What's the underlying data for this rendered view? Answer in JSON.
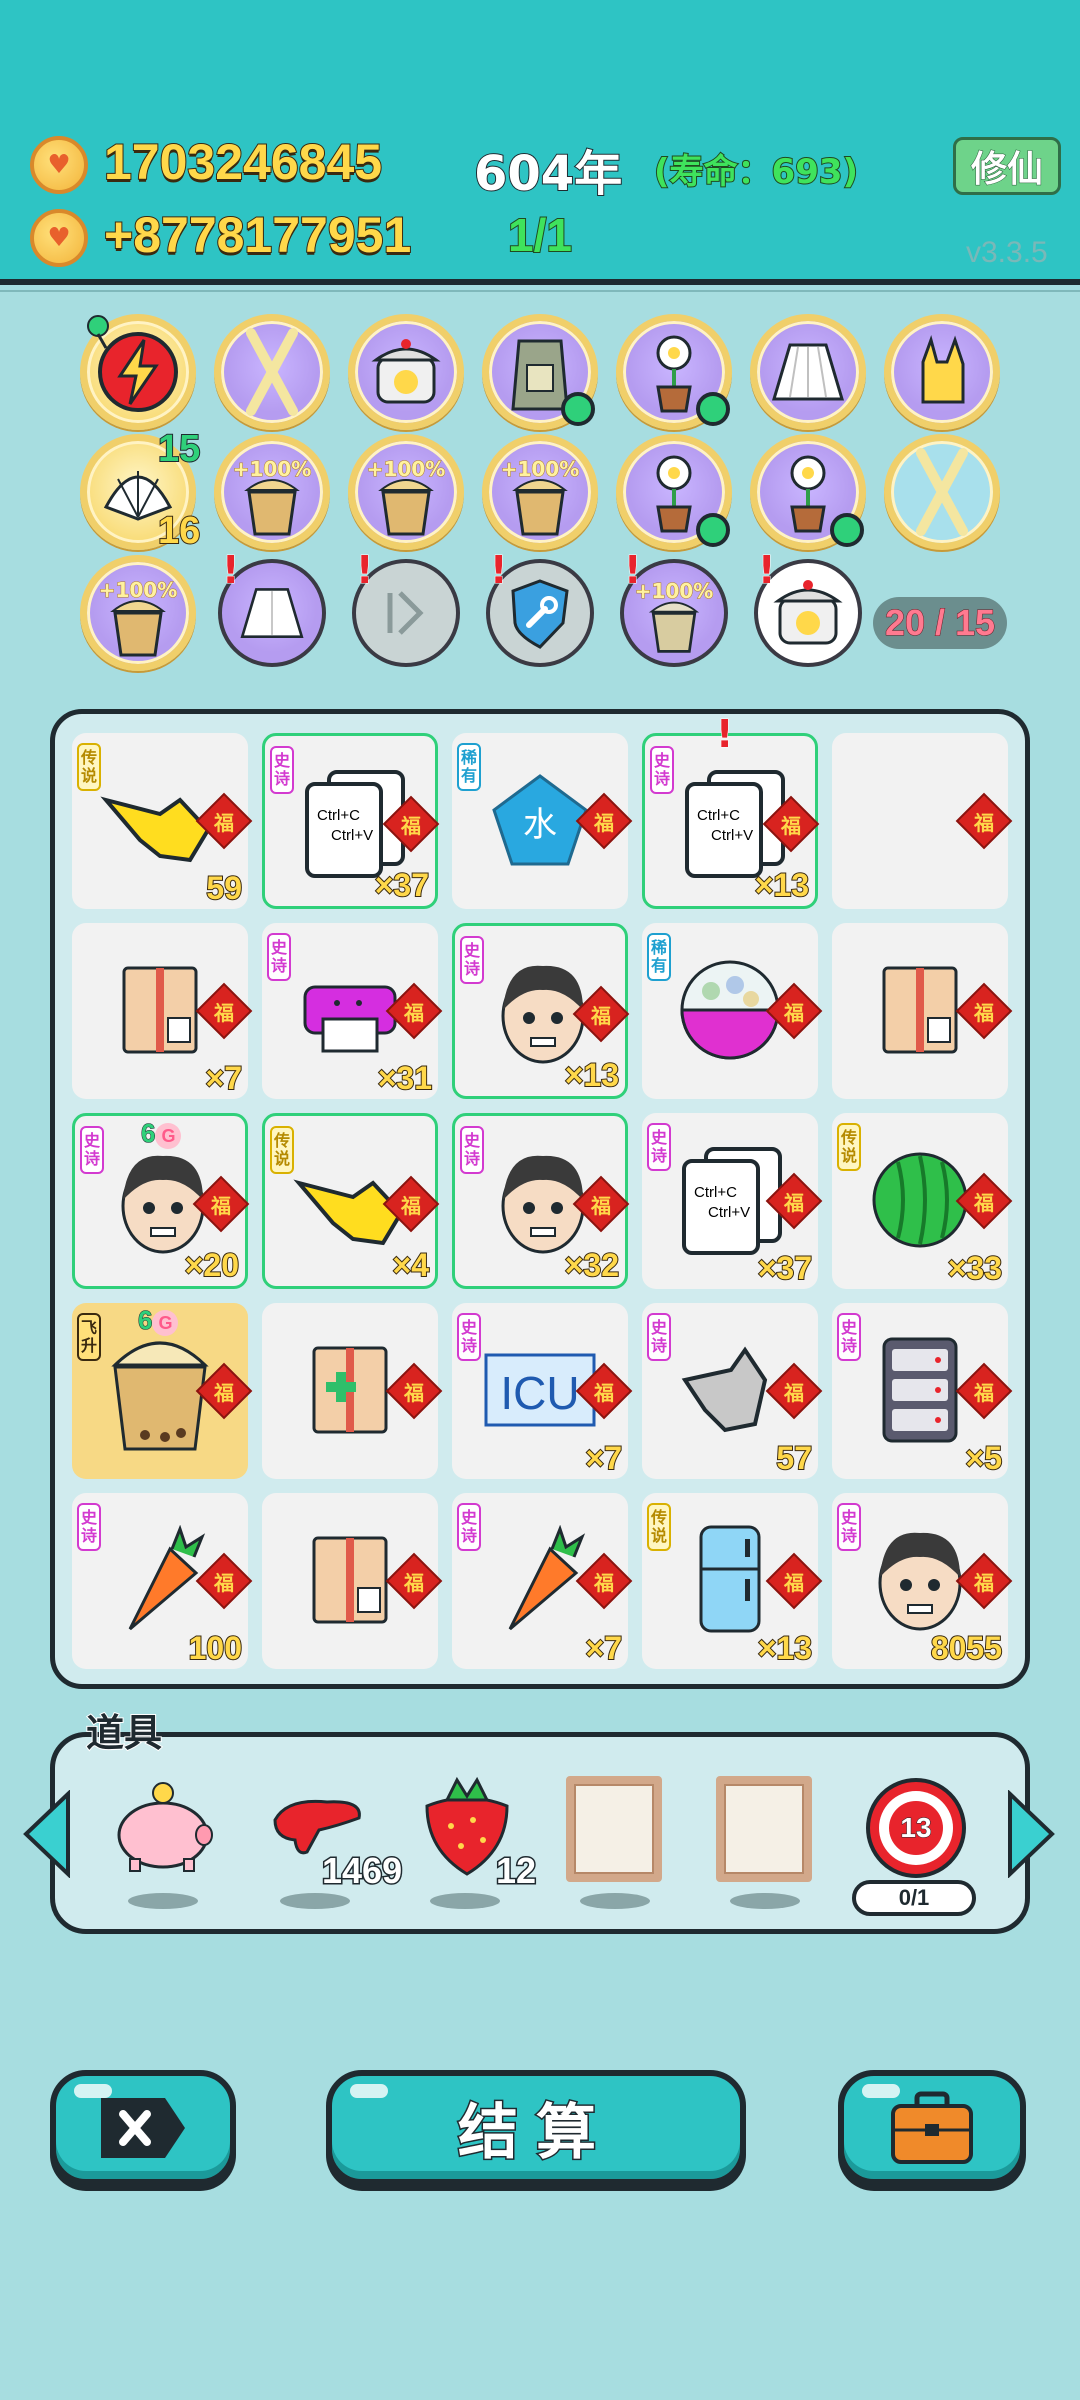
{
  "header": {
    "gold": "1703246845",
    "gold_rate": "+8778177951",
    "year": "604年",
    "lifespan": "(寿命：693)",
    "ratio": "1/1",
    "xiuxian_label": "修仙",
    "version": "v3.3.5"
  },
  "buffs": {
    "shell_count_top": "15",
    "shell_count_bottom": "16",
    "pct_label": "+100%",
    "slots_count": "20 / 15",
    "icons": [
      "lightning-icon",
      "chopsticks-icon",
      "rice-cooker-icon",
      "rice-bag-icon",
      "flower-pot-icon",
      "skirt-icon",
      "rock-hand-icon",
      "shell-icon",
      "boba-cup-icon",
      "boba-cup-icon",
      "boba-cup-icon",
      "flower-pot-icon",
      "flower-pot-icon",
      "chopsticks-icon",
      "boba-cup-icon",
      "skirt-icon",
      "skip-icon",
      "shield-wrench-icon",
      "boba-cup-icon",
      "rice-cooker-icon"
    ]
  },
  "grid": {
    "rarity": {
      "epic": "史诗",
      "legend": "传说",
      "rare": "稀有",
      "ascend": "飞升"
    },
    "fu": "福",
    "sixg": "6",
    "sixg_badge": "G",
    "clip_line1": "Ctrl+C",
    "clip_line2": "Ctrl+V",
    "water": "水",
    "icu": "ICU",
    "quantities": {
      "r1c1": "59",
      "r1c2": "×37",
      "r1c4": "×13",
      "r2c1": "×7",
      "r2c2": "×31",
      "r2c3": "×13",
      "r3c1": "×20",
      "r3c2": "×4",
      "r3c3": "×32",
      "r3c4": "×37",
      "r3c5": "×33",
      "r4c3": "×7",
      "r4c4": "57",
      "r4c5": "×5",
      "r5c1": "100",
      "r5c3": "×7",
      "r5c4": "×13",
      "r5c5": "8055"
    }
  },
  "items": {
    "title": "道具",
    "liver_count": "1469",
    "strawberry_count": "12",
    "target_level": "13",
    "target_progress": "0/1"
  },
  "buttons": {
    "settle": "结算"
  },
  "colors": {
    "header_bg": "#2ec4c4",
    "page_bg": "#a7dde0",
    "gold_text": "#ffd84a",
    "green_text": "#3fe35c",
    "fu_red": "#d8231f"
  }
}
